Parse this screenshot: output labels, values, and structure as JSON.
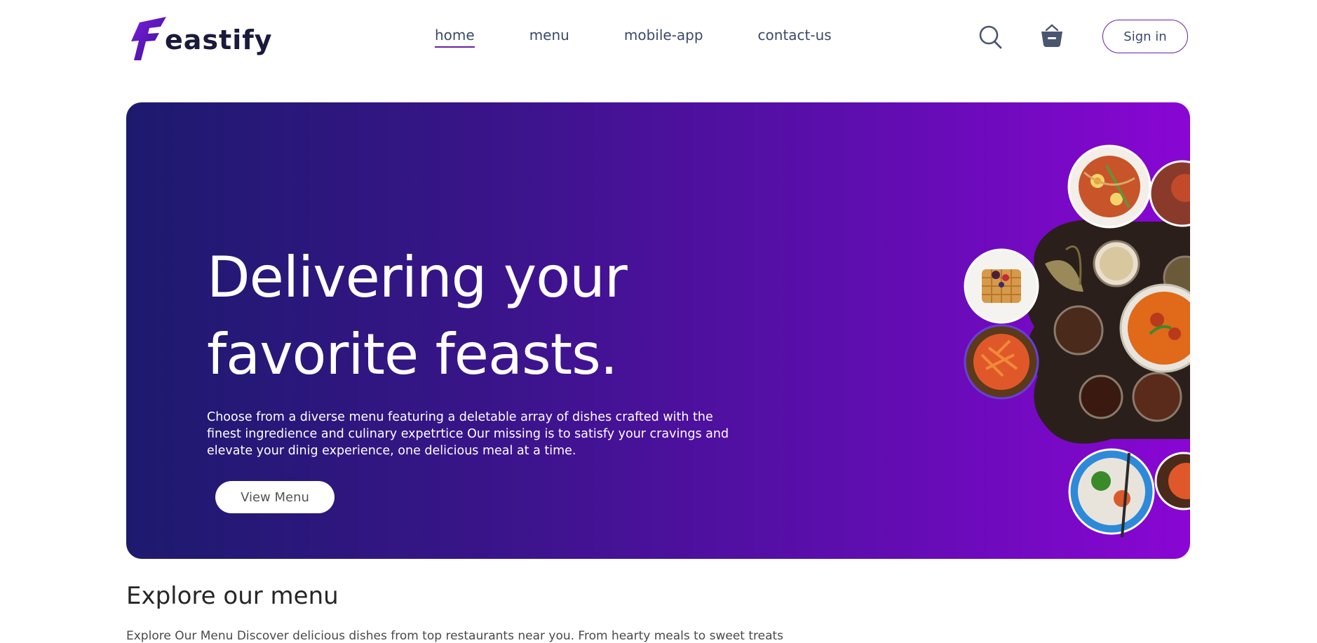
{
  "brand": {
    "name": "eastify",
    "mark_letter": "F"
  },
  "nav": {
    "items": [
      {
        "label": "home",
        "active": true
      },
      {
        "label": "menu",
        "active": false
      },
      {
        "label": "mobile-app",
        "active": false
      },
      {
        "label": "contact-us",
        "active": false
      }
    ],
    "accent_color": "#6a1fa3"
  },
  "header_actions": {
    "search_icon": "search-icon",
    "basket_icon": "basket-icon",
    "signin_label": "Sign in"
  },
  "hero": {
    "title_line1": "Delivering your",
    "title_line2": "favorite feasts.",
    "description": "Choose from a diverse menu featuring a deletable array of dishes crafted with the finest ingredience and culinary expetrtice Our missing is to satisfy your cravings and elevate your dinig experience, one delicious meal at a time.",
    "button_label": "View Menu",
    "gradient_start": "#1d1a6e",
    "gradient_end": "#8a06d4"
  },
  "explore": {
    "title": "Explore our menu",
    "description": "Explore Our Menu Discover delicious dishes from top restaurants near you. From hearty meals to sweet treats"
  }
}
